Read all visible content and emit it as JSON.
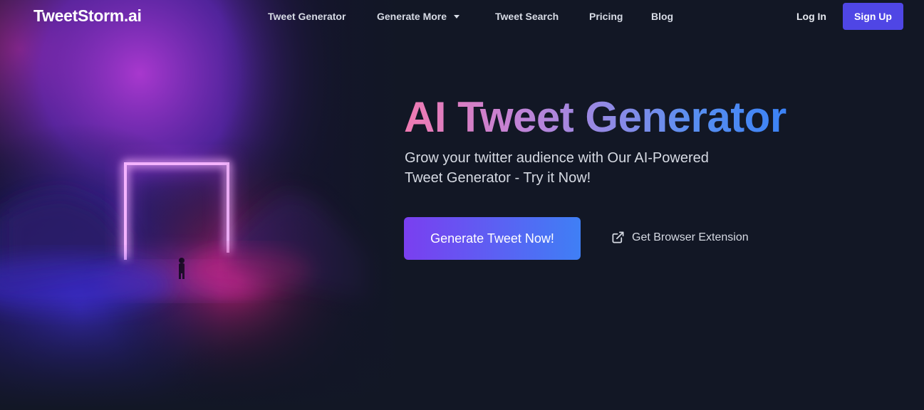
{
  "nav": {
    "logo": "TweetStorm.ai",
    "links": [
      {
        "label": "Tweet Generator"
      },
      {
        "label": "Generate More"
      },
      {
        "label": "Tweet Search"
      },
      {
        "label": "Pricing"
      },
      {
        "label": "Blog"
      }
    ],
    "login_label": "Log In",
    "signup_label": "Sign Up"
  },
  "hero": {
    "headline": "AI Tweet Generator",
    "subheadline": "Grow your twitter audience with Our AI-Powered Tweet Generator - Try it Now!",
    "cta_label": "Generate Tweet Now!",
    "extension_label": "Get Browser Extension"
  },
  "icons": {
    "dropdown": "chevron-down-icon",
    "extension": "external-link-icon"
  },
  "colors": {
    "background": "#121725",
    "signup_button": "#4f46e5",
    "headline_gradient": [
      "#f07ab1",
      "#3b82f6"
    ],
    "cta_gradient": [
      "#7a3ff0",
      "#3f7ff5"
    ],
    "neon_frame": "#e879f9"
  }
}
